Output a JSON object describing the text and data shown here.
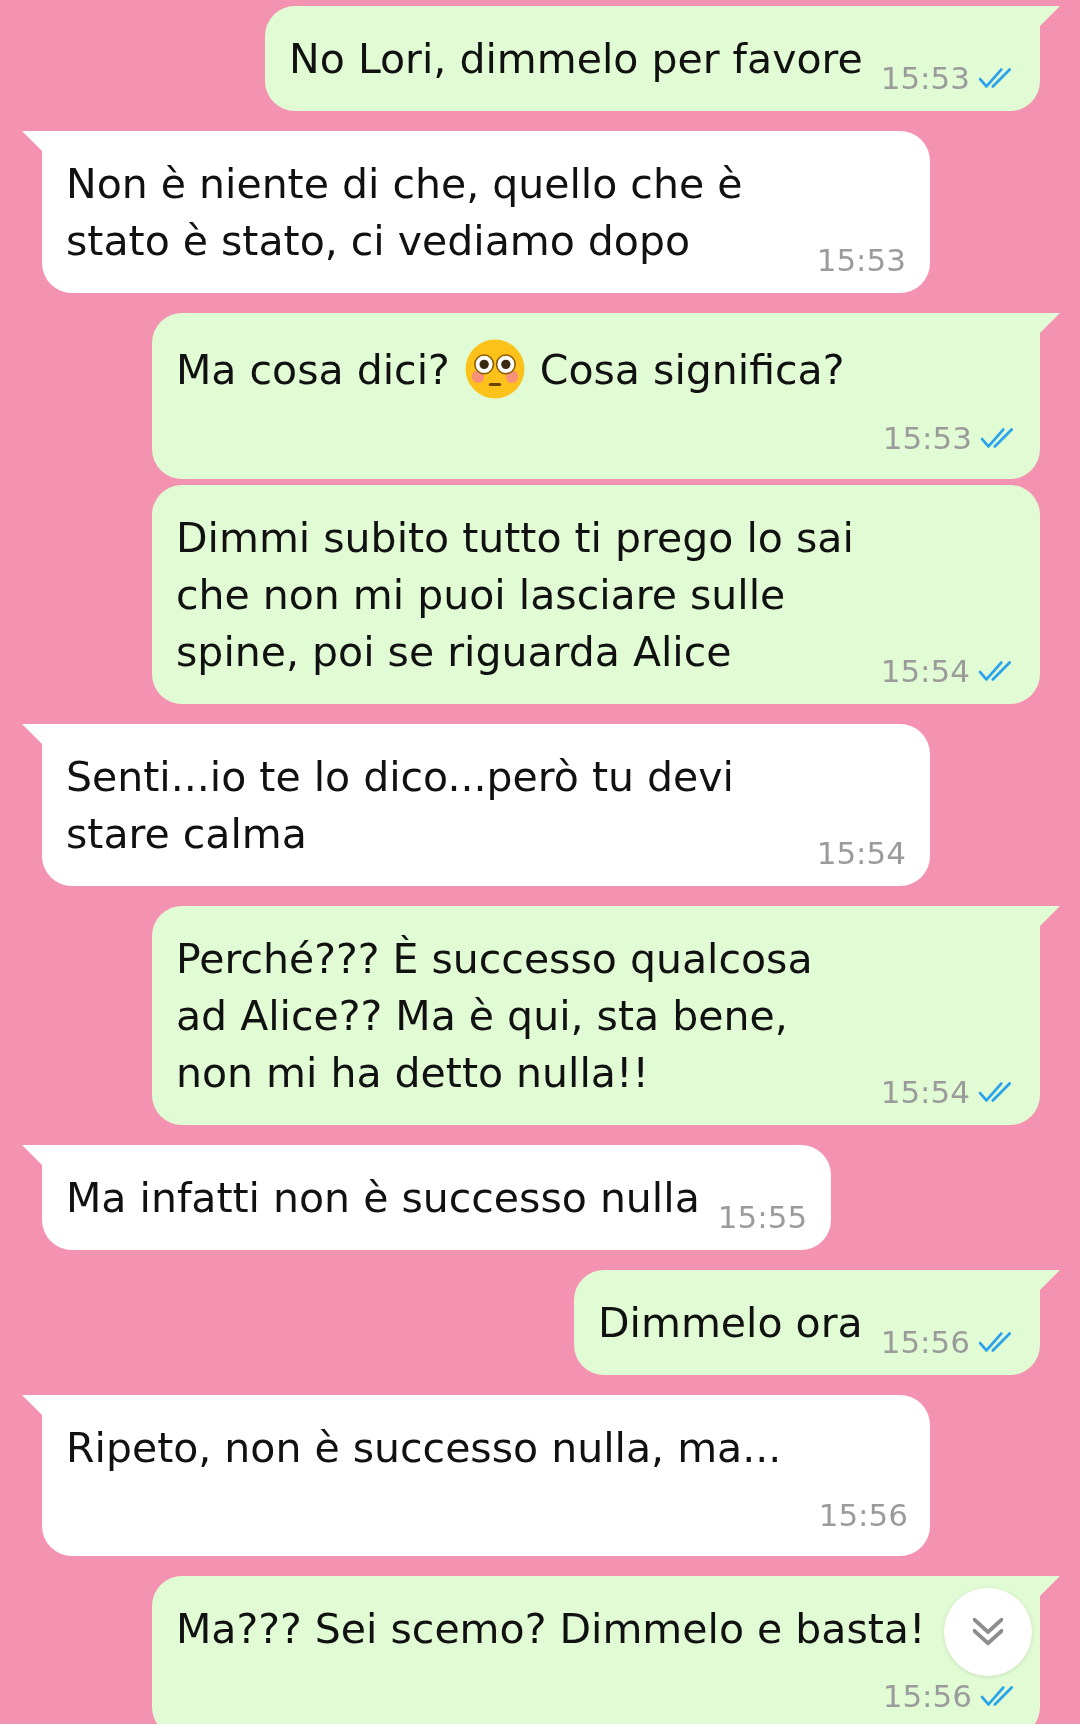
{
  "messages": [
    {
      "outgoing": true,
      "tail": true,
      "time_below": false,
      "text": "No Lori, dimmelo per favore",
      "time": "15:53",
      "read": true
    },
    {
      "outgoing": false,
      "tail": true,
      "time_below": false,
      "text": "Non è niente di che, quello che è stato è stato, ci vediamo dopo",
      "time": "15:53"
    },
    {
      "outgoing": true,
      "tail": true,
      "time_below": true,
      "segments": [
        {
          "kind": "text",
          "text": "Ma cosa dici?"
        },
        {
          "kind": "emoji"
        },
        {
          "kind": "text",
          "text": "Cosa significa?"
        }
      ],
      "time": "15:53",
      "read": true
    },
    {
      "outgoing": true,
      "tail": false,
      "time_below": false,
      "text": "Dimmi subito tutto ti prego lo sai che non mi puoi lasciare sulle spine, poi se riguarda Alice",
      "time": "15:54",
      "read": true
    },
    {
      "outgoing": false,
      "tail": true,
      "time_below": false,
      "text": "Senti...io te lo dico...però tu devi stare calma",
      "time": "15:54"
    },
    {
      "outgoing": true,
      "tail": true,
      "time_below": false,
      "text": "Perché??? È successo qualcosa ad Alice?? Ma è qui, sta bene, non mi ha detto nulla!!",
      "time": "15:54",
      "read": true
    },
    {
      "outgoing": false,
      "tail": true,
      "time_below": false,
      "text": "Ma infatti non è successo nulla",
      "time": "15:55"
    },
    {
      "outgoing": true,
      "tail": true,
      "time_below": false,
      "text": "Dimmelo ora",
      "time": "15:56",
      "read": true
    },
    {
      "outgoing": false,
      "tail": true,
      "time_below": true,
      "text": "Ripeto, non è successo nulla, ma...",
      "time": "15:56"
    },
    {
      "outgoing": true,
      "tail": true,
      "time_below": true,
      "text": "Ma??? Sei scemo? Dimmelo e basta!",
      "time": "15:56",
      "read": true
    }
  ]
}
